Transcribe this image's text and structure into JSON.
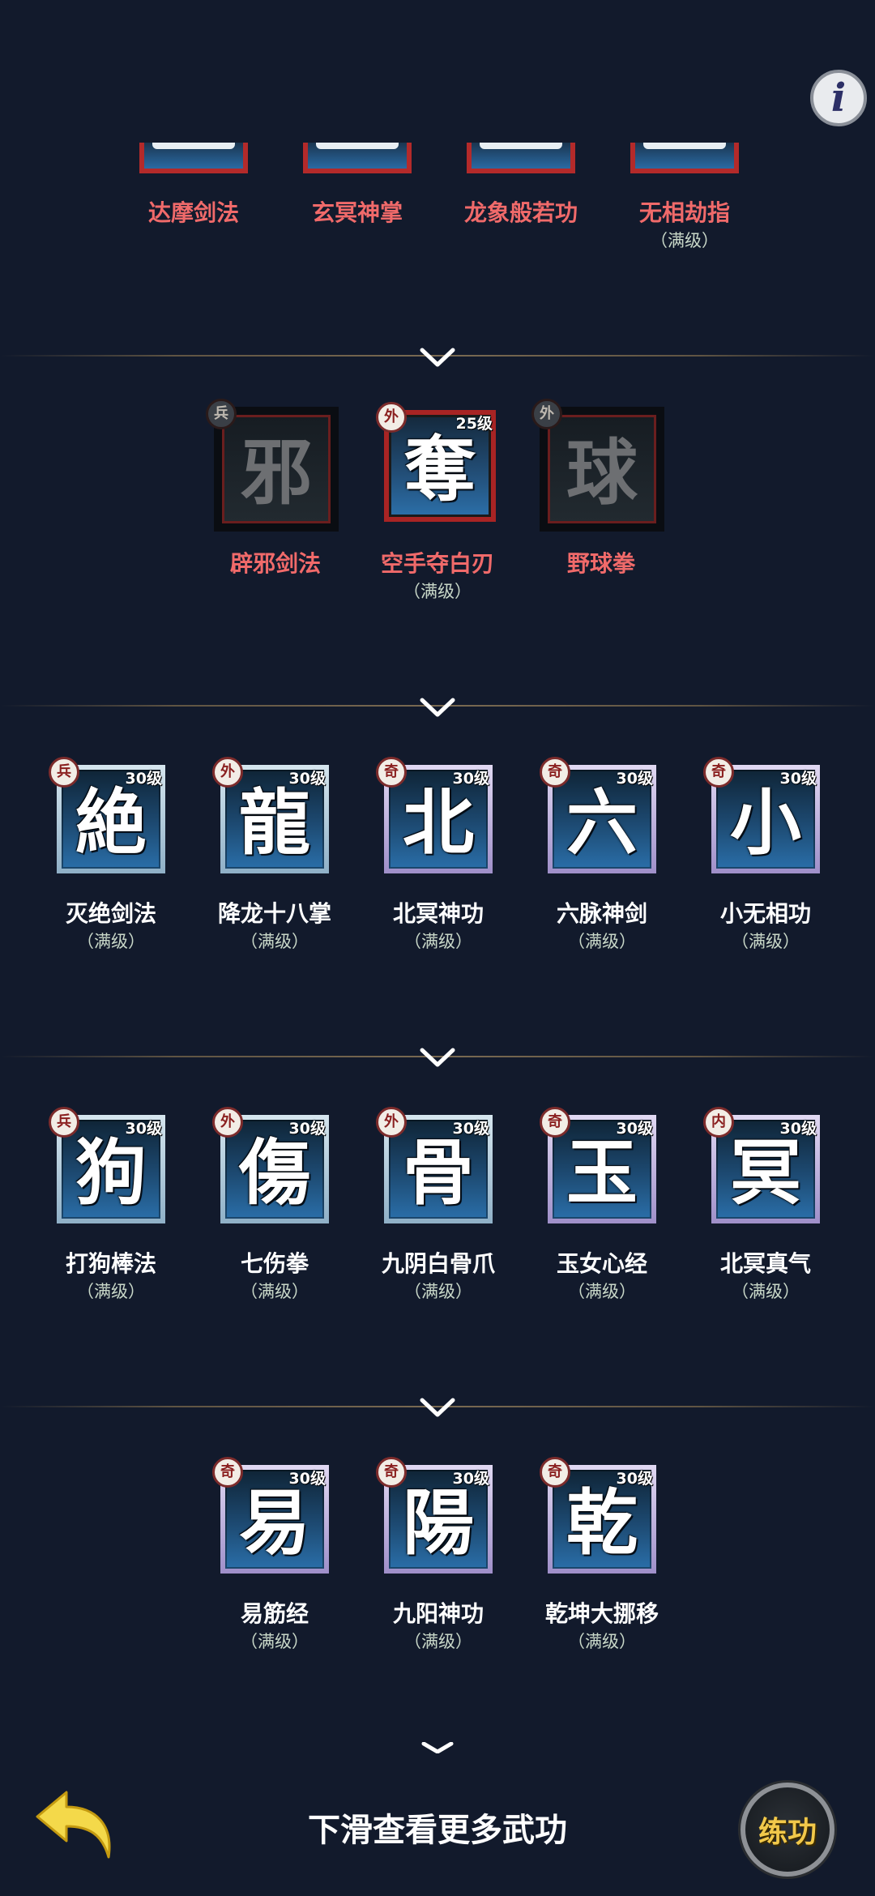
{
  "info_button": {
    "icon": "info-icon",
    "label": "i"
  },
  "top_row": [
    {
      "name": "达摩剑法",
      "sub": ""
    },
    {
      "name": "玄冥神掌",
      "sub": ""
    },
    {
      "name": "龙象般若功",
      "sub": ""
    },
    {
      "name": "无相劫指",
      "sub": "（满级）"
    }
  ],
  "row2": [
    {
      "char": "邪",
      "badge": "兵",
      "level": "",
      "name": "辟邪剑法",
      "sub": "",
      "state": "locked"
    },
    {
      "char": "奪",
      "badge": "外",
      "level": "25级",
      "name": "空手夺白刃",
      "sub": "（满级）",
      "state": "red"
    },
    {
      "char": "球",
      "badge": "外",
      "level": "",
      "name": "野球拳",
      "sub": "",
      "state": "locked"
    }
  ],
  "row3": [
    {
      "char": "絶",
      "badge": "兵",
      "level": "30级",
      "name": "灭绝剑法",
      "sub": "（满级）"
    },
    {
      "char": "龍",
      "badge": "外",
      "level": "30级",
      "name": "降龙十八掌",
      "sub": "（满级）"
    },
    {
      "char": "北",
      "badge": "奇",
      "level": "30级",
      "name": "北冥神功",
      "sub": "（满级）"
    },
    {
      "char": "六",
      "badge": "奇",
      "level": "30级",
      "name": "六脉神剑",
      "sub": "（满级）"
    },
    {
      "char": "小",
      "badge": "奇",
      "level": "30级",
      "name": "小无相功",
      "sub": "（满级）"
    }
  ],
  "row4": [
    {
      "char": "狗",
      "badge": "兵",
      "level": "30级",
      "name": "打狗棒法",
      "sub": "（满级）"
    },
    {
      "char": "傷",
      "badge": "外",
      "level": "30级",
      "name": "七伤拳",
      "sub": "（满级）"
    },
    {
      "char": "骨",
      "badge": "外",
      "level": "30级",
      "name": "九阴白骨爪",
      "sub": "（满级）"
    },
    {
      "char": "玉",
      "badge": "奇",
      "level": "30级",
      "name": "玉女心经",
      "sub": "（满级）"
    },
    {
      "char": "冥",
      "badge": "内",
      "level": "30级",
      "name": "北冥真气",
      "sub": "（满级）"
    }
  ],
  "row5": [
    {
      "char": "易",
      "badge": "奇",
      "level": "30级",
      "name": "易筋经",
      "sub": "（满级）"
    },
    {
      "char": "陽",
      "badge": "奇",
      "level": "30级",
      "name": "九阳神功",
      "sub": "（满级）"
    },
    {
      "char": "乾",
      "badge": "奇",
      "level": "30级",
      "name": "乾坤大挪移",
      "sub": "（满级）"
    }
  ],
  "footer": {
    "hint": "下滑查看更多武功",
    "back_icon": "back-arrow-icon",
    "practice_label": "练功"
  },
  "colors": {
    "background": "#121a2c",
    "locked_name": "#f06a6a",
    "accent": "#f1c84a"
  }
}
